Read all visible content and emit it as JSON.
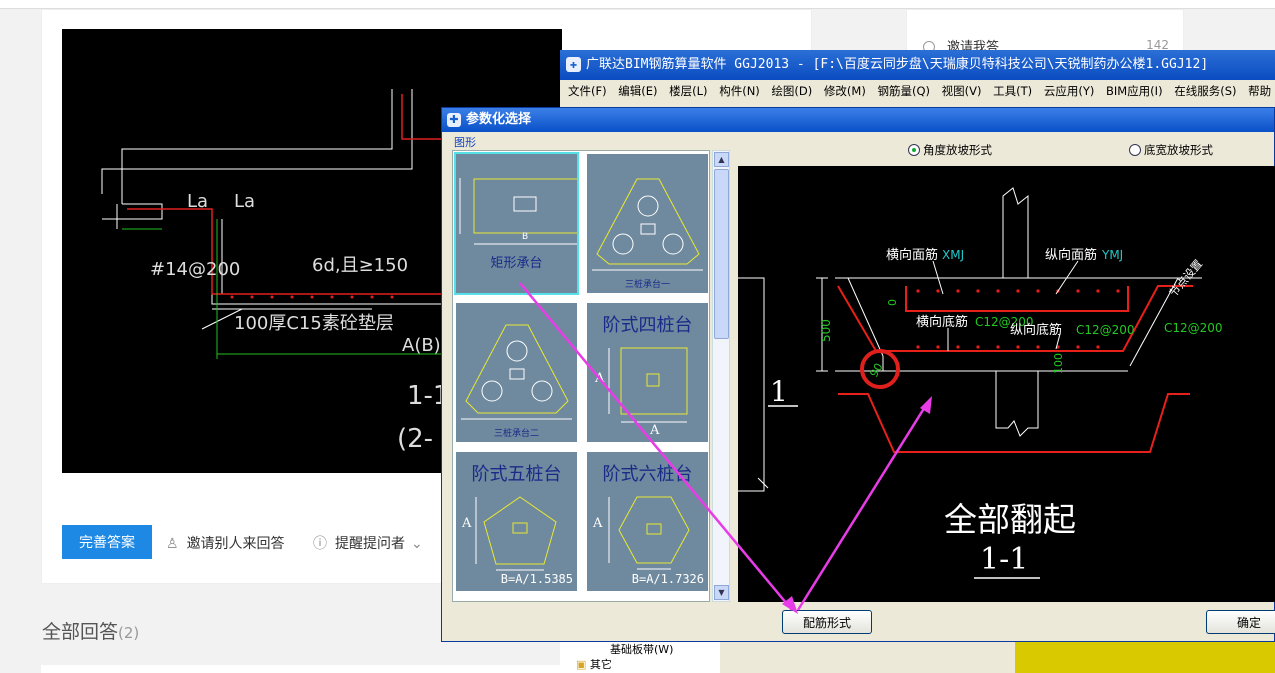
{
  "qa_page": {
    "complete_answer_button": "完善答案",
    "invite_label": "邀请别人来回答",
    "remind_label": "提醒提问者",
    "answers_title": "全部回答",
    "answers_count": "(2)",
    "side_invite_label": "邀请我答",
    "side_invite_count": "142",
    "cad_photo": {
      "texts": [
        "La",
        "La",
        "#14@200",
        "6d,且≥150",
        "100厚C15素砼垫层",
        "A(B)",
        "1-1",
        "(2-"
      ]
    }
  },
  "app": {
    "title": "广联达BIM钢筋算量软件 GGJ2013 - [F:\\百度云同步盘\\天瑞康贝特科技公司\\天锐制药办公楼1.GGJ12]",
    "menu": [
      "文件(F)",
      "编辑(E)",
      "楼层(L)",
      "构件(N)",
      "绘图(D)",
      "修改(M)",
      "钢筋量(Q)",
      "视图(V)",
      "工具(T)",
      "云应用(Y)",
      "BIM应用(I)",
      "在线服务(S)",
      "帮助"
    ],
    "tree_items": [
      "基础板带(W)",
      "其它"
    ]
  },
  "dialog": {
    "title": "参数化选择",
    "group_label": "图形",
    "shapes": [
      {
        "label": "矩形承台",
        "selected": true
      },
      {
        "label": "三桩承台一",
        "selected": false
      },
      {
        "label": "三桩承台二",
        "selected": false
      },
      {
        "label": "阶式四桩台",
        "selected": false
      },
      {
        "label": "阶式五桩台",
        "selected": false,
        "formula": "B=A/1.5385"
      },
      {
        "label": "阶式六桩台",
        "selected": false,
        "formula": "B=A/1.7326"
      }
    ],
    "tile_dims": {
      "B": "B",
      "A": "A"
    },
    "radio_options": [
      {
        "label": "角度放坡形式",
        "checked": true
      },
      {
        "label": "底宽放坡形式",
        "checked": false
      }
    ],
    "preview": {
      "label_top_h": "横向面筋",
      "code_top_h": "XMJ",
      "label_top_v": "纵向面筋",
      "code_top_v": "YMJ",
      "label_corner": "节点设置",
      "label_bot_h": "横向底筋",
      "spec_bot_h": "C12@200",
      "label_bot_v": "纵向底筋",
      "spec_bot_v": "C12@200",
      "spec_right": "C12@200",
      "dim_500": "500",
      "dim_0": "0",
      "dim_90": "90",
      "dim_100": "100",
      "section_mark": "1",
      "caption": "全部翻起",
      "section_title": "1-1"
    },
    "buttons": {
      "rebar_form": "配筋形式",
      "ok": "确定"
    }
  },
  "colors": {
    "annotation_arrow": "#e83ce8",
    "highlight_circle": "#e0201c",
    "rebar": "#e8201a",
    "tile_bg": "#6f8a9f",
    "selection": "#55e0e8"
  }
}
